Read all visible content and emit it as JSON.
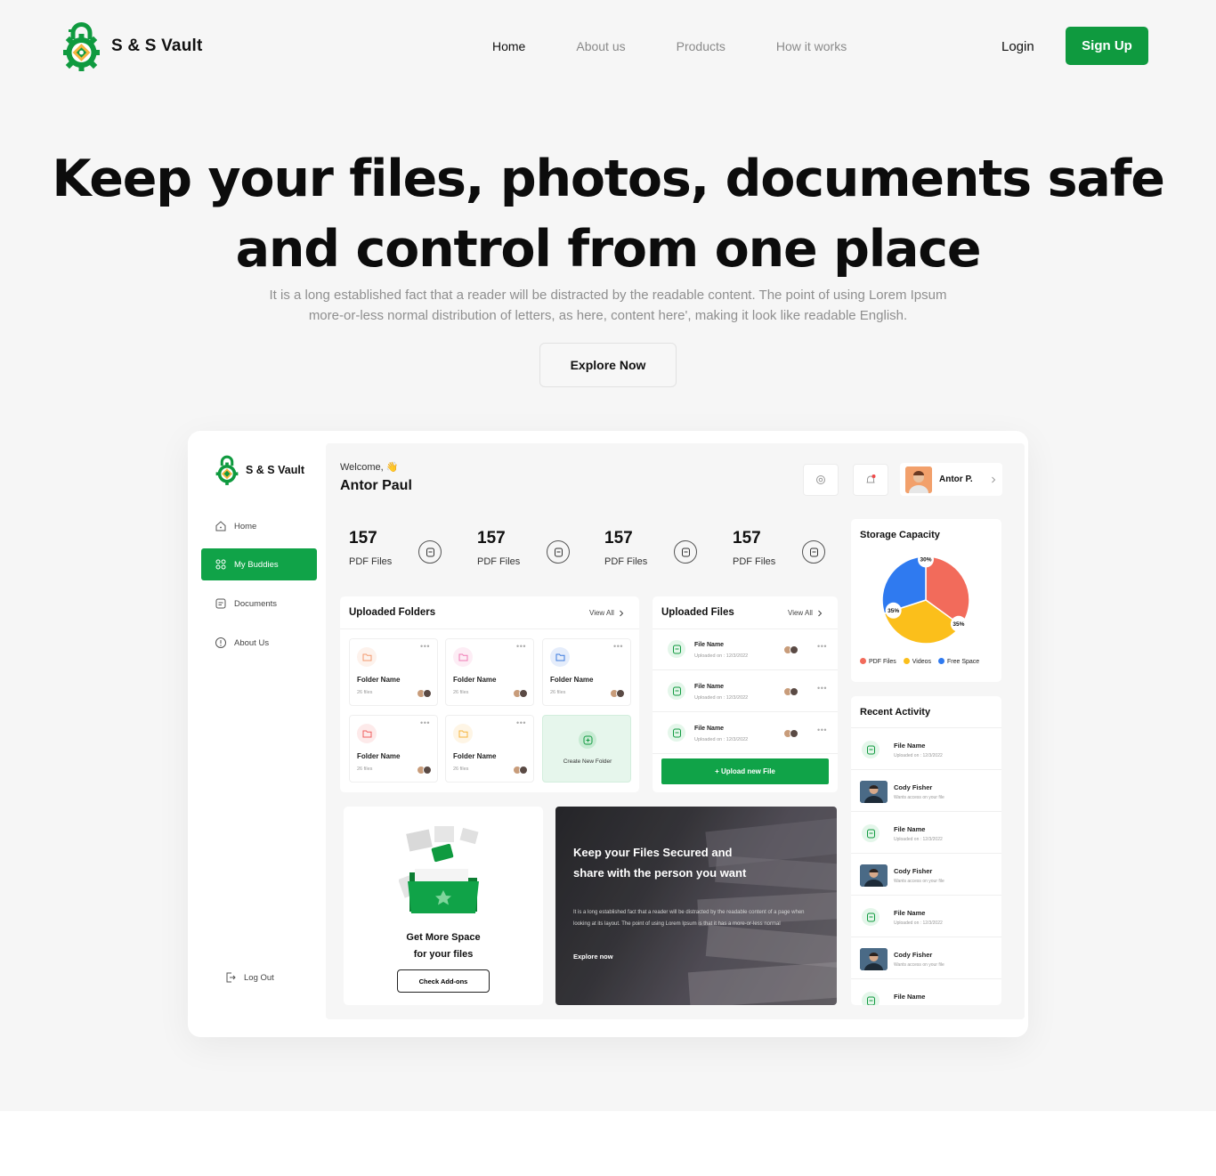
{
  "brand": {
    "name": "S & S Vault",
    "accent": "#0f9a3f"
  },
  "nav": {
    "links": [
      "Home",
      "About us",
      "Products",
      "How it works"
    ],
    "active": "Home",
    "login": "Login",
    "signup": "Sign Up"
  },
  "hero": {
    "title_line1": "Keep your files, photos, documents safe",
    "title_line2": "and control from one place",
    "subtitle_line1": "It is a long established fact that a reader will be distracted by the readable content. The point of using Lorem Ipsum",
    "subtitle_line2": "more-or-less normal distribution of letters, as here, content here', making it look like readable English.",
    "cta": "Explore Now"
  },
  "dashboard": {
    "sidebar": {
      "logo": "S & S Vault",
      "items": [
        {
          "label": "Home",
          "icon": "home-icon"
        },
        {
          "label": "My Buddies",
          "icon": "buddies-icon",
          "active": true
        },
        {
          "label": "Documents",
          "icon": "document-icon"
        },
        {
          "label": "About Us",
          "icon": "info-icon"
        }
      ],
      "logout": "Log Out"
    },
    "header": {
      "welcome": "Welcome, 👋",
      "user": "Antor Paul",
      "profile_name": "Antor P."
    },
    "stats": [
      {
        "value": "157",
        "label": "PDF Files",
        "color": "#e3f6ea"
      },
      {
        "value": "157",
        "label": "PDF Files",
        "color": "#fdf0cf"
      },
      {
        "value": "157",
        "label": "PDF Files",
        "color": "#fde8e1"
      },
      {
        "value": "157",
        "label": "PDF Files",
        "color": "#e3eefd"
      }
    ],
    "folders": {
      "title": "Uploaded Folders",
      "view_all": "View All",
      "items": [
        {
          "name": "Folder Name",
          "files": "26 files",
          "color": "#f39a6f"
        },
        {
          "name": "Folder Name",
          "files": "26 files",
          "color": "#f07bb5"
        },
        {
          "name": "Folder Name",
          "files": "26 files",
          "color": "#3d7bde"
        },
        {
          "name": "Folder Name",
          "files": "26 files",
          "color": "#f06060"
        },
        {
          "name": "Folder Name",
          "files": "26 files",
          "color": "#f5b53d"
        }
      ],
      "create": "Create New Folder"
    },
    "files": {
      "title": "Uploaded Files",
      "view_all": "View All",
      "items": [
        {
          "name": "File Name",
          "date": "Uploaded on : 12/3/2022"
        },
        {
          "name": "File Name",
          "date": "Uploaded on : 12/3/2022"
        },
        {
          "name": "File Name",
          "date": "Uploaded on : 12/3/2022"
        }
      ],
      "upload": "+ Upload new File"
    },
    "storage": {
      "title": "Storage Capacity",
      "legend": [
        {
          "label": "PDF Files",
          "color": "#f26b5b"
        },
        {
          "label": "Videos",
          "color": "#fbbf1b"
        },
        {
          "label": "Free Space",
          "color": "#2f7af0"
        }
      ]
    },
    "chart_data": {
      "type": "pie",
      "title": "Storage Capacity",
      "categories": [
        "PDF Files",
        "Videos",
        "Free Space"
      ],
      "values": [
        35,
        35,
        30
      ],
      "labels": [
        "35%",
        "35%",
        "30%"
      ],
      "colors": [
        "#f26b5b",
        "#fbbf1b",
        "#2f7af0"
      ]
    },
    "activity": {
      "title": "Recent Activity",
      "items": [
        {
          "type": "file",
          "name": "File Name",
          "sub": "Uploaded on : 12/3/2022"
        },
        {
          "type": "user",
          "name": "Cody Fisher",
          "sub": "Wants access on your file"
        },
        {
          "type": "file",
          "name": "File Name",
          "sub": "Uploaded on : 12/3/2022"
        },
        {
          "type": "user",
          "name": "Cody Fisher",
          "sub": "Wants access on your file"
        },
        {
          "type": "file",
          "name": "File Name",
          "sub": "Uploaded on : 12/3/2022"
        },
        {
          "type": "user",
          "name": "Cody Fisher",
          "sub": "Wants access on your file"
        },
        {
          "type": "file",
          "name": "File Name",
          "sub": ""
        }
      ]
    },
    "promo": {
      "line1": "Get More Space",
      "line2": "for your files",
      "cta": "Check Add-ons"
    },
    "secure": {
      "title": "Keep your Files Secured and share with the person you want",
      "desc": "It is a long established fact that a reader will be distracted by the readable content of a page when looking at its layout. The point of using Lorem Ipsum is that it has a more-or-less normal",
      "link": "Explore now"
    }
  }
}
